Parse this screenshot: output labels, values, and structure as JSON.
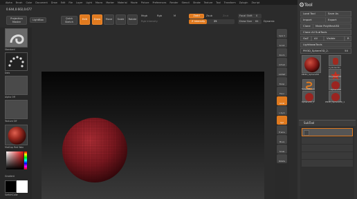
{
  "menubar": [
    "Alpha",
    "Brush",
    "Color",
    "Document",
    "Draw",
    "Edit",
    "File",
    "Layer",
    "Light",
    "Macro",
    "Marker",
    "Material",
    "Movie",
    "Picture",
    "Preferences",
    "Render",
    "Stencil",
    "Stroke",
    "Texture",
    "Tool",
    "Transform",
    "Zplugin",
    "Zscript"
  ],
  "coords": "0.644,0.602,0.677",
  "toolbar": {
    "projection_master": "Projection Master",
    "lightbox": "LightBox",
    "quick_sketch": "Quick Sketch",
    "edit": "Edit",
    "draw": "Draw",
    "move": "Move",
    "scale": "Scale",
    "rotate": "Rotate",
    "mrgb": "Mrgb",
    "rgb": "Rgb",
    "m": "M",
    "rgb_intensity": "Rgb Intensity",
    "zadd": "Zadd",
    "zsub": "Zsub",
    "zcut": "Zcut",
    "z_intensity_label": "Z Intensity",
    "z_intensity_value": "25",
    "focal_shift_label": "Focal Shift",
    "focal_shift_value": "0",
    "draw_size_label": "Draw Size",
    "draw_size_value": "64",
    "dynamic": "Dynamic"
  },
  "left_shelf": {
    "brush_label": "Standard",
    "stroke_label": "Dots",
    "alpha_label": "Alpha Off",
    "texture_label": "Texture Off",
    "material_label": "MatCap Red Wax",
    "gradient_label": "Gradient",
    "switch_color_label": "SwitchColor"
  },
  "right_strip": [
    "Spix 3",
    "Scroll",
    "Zoom",
    "Actual",
    "AAHalf",
    "Persp",
    "Floor",
    "Local",
    "L.Sym",
    "Xyz",
    "Frame",
    "Move",
    "Scale",
    "Rotate"
  ],
  "tool_panel": {
    "title": "Tool",
    "load_tool": "Load Tool",
    "save_as": "Save As",
    "import": "Import",
    "export": "Export",
    "clone": "Clone",
    "make_polymesh": "Make PolyMesh3D",
    "clone_all": "Clone All SubTools",
    "goz": "GoZ",
    "all": "All",
    "visible": "Visible",
    "r": "R",
    "lightbox_tools": "Lightbox▸Tools",
    "current_tool": "PM3D_Sphere3D_2.",
    "current_value": "50",
    "tools": [
      {
        "name": "PM3D_Sphere3D"
      },
      {
        "name": "Cylinder3D"
      },
      {
        "name": "PolyMesh3D"
      },
      {
        "name": "SimpleBrush"
      },
      {
        "name": "Sphere3D"
      },
      {
        "name": "Sphere3D_1"
      },
      {
        "name": "PM3D_Sphere3D_1"
      }
    ],
    "subtool": "SubTool"
  },
  "colors": {
    "accent": "#e07a1f",
    "sphere": "#8a1c22",
    "panel": "#333333"
  }
}
